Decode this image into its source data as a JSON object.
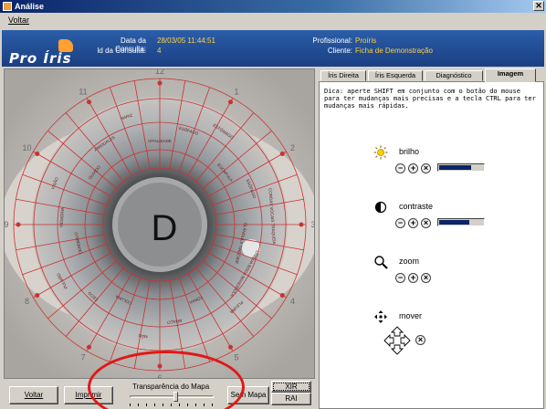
{
  "window": {
    "title": "Análise",
    "close_glyph": "✕"
  },
  "menu": {
    "voltar": "Voltar"
  },
  "header": {
    "logo_text": "Pro Íris",
    "data_consulta_label": "Data da Consulta:",
    "data_consulta_value": "28/03/05 11:44:51",
    "id_consulta_label": "Id da Consulta:",
    "id_consulta_value": "4",
    "profissional_label": "Profissional:",
    "profissional_value": "Proíris",
    "cliente_label": "Cliente:",
    "cliente_value": "Ficha de Demonstração"
  },
  "iris": {
    "eye_letter": "D",
    "clock_numbers": [
      "12",
      "1",
      "2",
      "3",
      "4",
      "5",
      "6",
      "7",
      "8",
      "9",
      "10",
      "11"
    ],
    "zone_labels": [
      "VITALIDADE",
      "ESÔFAGO",
      "ESTÔMAGO",
      "ESCAPULA",
      "ESÔFAGO",
      "CORDAS VOCAIS TRAQUEIA",
      "GLÂNDULA TIREÓIDE",
      "LÍNGUA BOCA MANDÍBULA",
      "PLEURA",
      "TÓRAX",
      "BRAÇO",
      "MÃO",
      "COLUNA",
      "CECO",
      "PULMÃO",
      "CEREBELO",
      "MEMÓRIA",
      "VISÃO",
      "OUVIDO",
      "AMÍGDALAS",
      "NARIZ"
    ]
  },
  "tabs": [
    {
      "label": "Íris Direita",
      "active": false
    },
    {
      "label": "Íris Esquerda",
      "active": false
    },
    {
      "label": "Diagnóstico",
      "active": false
    },
    {
      "label": "Imagem",
      "active": true
    }
  ],
  "image_tab": {
    "hint": "Dica: aperte SHIFT em conjunto com o botão do mouse para ter mudanças mais precisas e a tecla CTRL para ter mudanças mais rápidas.",
    "controls": [
      {
        "label": "brilho",
        "icon": "sun-icon",
        "level": 0.72
      },
      {
        "label": "contraste",
        "icon": "contrast-icon",
        "level": 0.68
      },
      {
        "label": "zoom",
        "icon": "magnifier-icon"
      },
      {
        "label": "mover",
        "icon": "move-icon"
      }
    ],
    "minus_glyph": "−",
    "plus_glyph": "+",
    "reset_glyph": "×"
  },
  "bottom": {
    "voltar": "Voltar",
    "imprimir": "Imprimir",
    "transparencia_label": "Transparência do Mapa",
    "transparencia_level": 0.55,
    "sem_mapa": "Sem Mapa",
    "xir": "XIR",
    "rai": "RAI"
  },
  "colors": {
    "header_blue": "#1a3f83",
    "highlight_yellow": "#ffd040",
    "annotation_red": "#e01818",
    "map_red": "#c83232",
    "bar_blue": "#0a246a"
  }
}
